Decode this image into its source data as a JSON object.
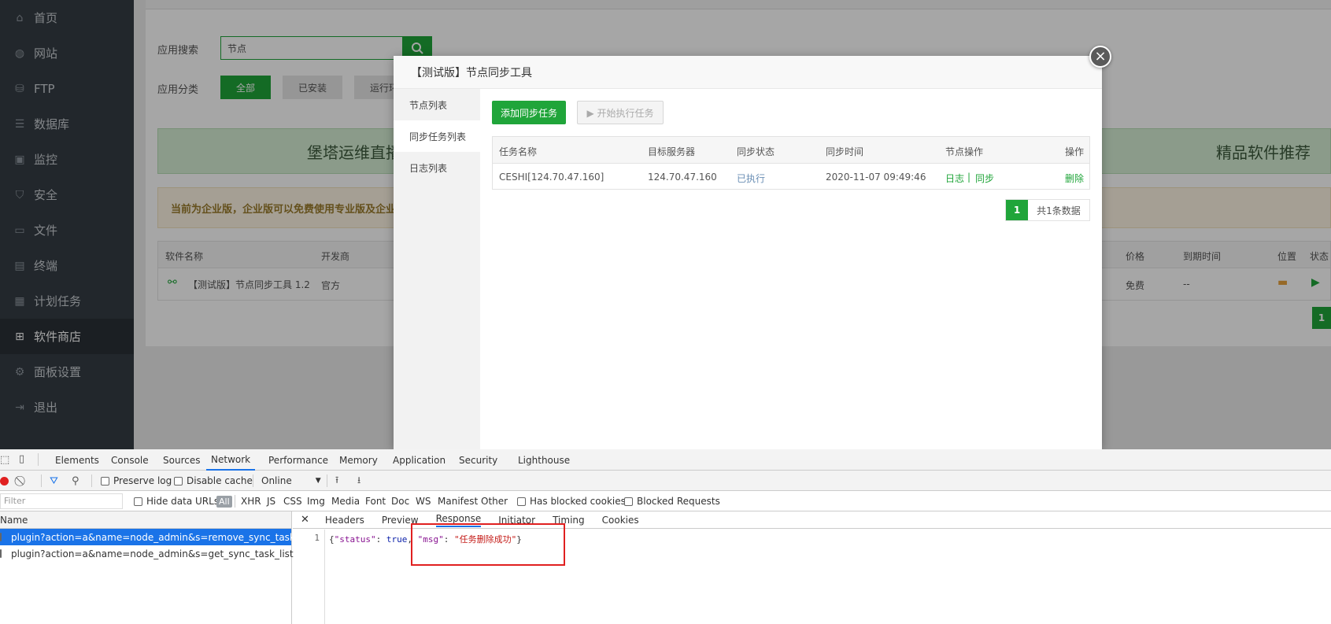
{
  "sidebar": {
    "items": [
      {
        "label": "首页",
        "icon": "home-icon"
      },
      {
        "label": "网站",
        "icon": "globe-icon"
      },
      {
        "label": "FTP",
        "icon": "ftp-icon"
      },
      {
        "label": "数据库",
        "icon": "database-icon"
      },
      {
        "label": "监控",
        "icon": "monitor-icon"
      },
      {
        "label": "安全",
        "icon": "shield-icon"
      },
      {
        "label": "文件",
        "icon": "folder-icon"
      },
      {
        "label": "终端",
        "icon": "terminal-icon"
      },
      {
        "label": "计划任务",
        "icon": "calendar-icon"
      },
      {
        "label": "软件商店",
        "icon": "grid-icon"
      },
      {
        "label": "面板设置",
        "icon": "gear-icon"
      },
      {
        "label": "退出",
        "icon": "logout-icon"
      }
    ],
    "active_index": 9
  },
  "main": {
    "search_label": "应用搜索",
    "search_value": "节点",
    "category_label": "应用分类",
    "categories": [
      "全部",
      "已安装",
      "运行环"
    ],
    "banner_left": "堡塔运维直播",
    "banner_right": "精品软件推荐",
    "notice": "当前为企业版，企业版可以免费使用专业版及企业",
    "soft_table": {
      "headers": [
        "软件名称",
        "开发商",
        "价格",
        "到期时间",
        "位置",
        "状态"
      ],
      "row": {
        "name": "【测试版】节点同步工具 1.2",
        "vendor": "官方",
        "price": "免费",
        "expire": "--"
      }
    },
    "page": "1"
  },
  "modal": {
    "title": "【测试版】节点同步工具",
    "tabs": [
      "节点列表",
      "同步任务列表",
      "日志列表"
    ],
    "active_tab": 1,
    "add_button": "添加同步任务",
    "run_button": "▶ 开始执行任务",
    "table": {
      "headers": [
        "任务名称",
        "目标服务器",
        "同步状态",
        "同步时间",
        "节点操作",
        "操作"
      ],
      "rows": [
        {
          "name": "CESHI[124.70.47.160]",
          "server": "124.70.47.160",
          "status": "已执行",
          "time": "2020-11-07 09:49:46",
          "node_log": "日志",
          "node_sep": "|",
          "node_sync": "同步",
          "action": "删除"
        }
      ]
    },
    "pager": {
      "current": "1",
      "info": "共1条数据"
    }
  },
  "devtools": {
    "tabs": [
      "Elements",
      "Console",
      "Sources",
      "Network",
      "Performance",
      "Memory",
      "Application",
      "Security",
      "Lighthouse"
    ],
    "active_tab": "Network",
    "toolbar": {
      "preserve_log": "Preserve log",
      "disable_cache": "Disable cache",
      "throttle": "Online"
    },
    "filterbar": {
      "placeholder": "Filter",
      "hide_data_urls": "Hide data URLs",
      "types": [
        "All",
        "XHR",
        "JS",
        "CSS",
        "Img",
        "Media",
        "Font",
        "Doc",
        "WS",
        "Manifest",
        "Other"
      ],
      "has_blocked": "Has blocked cookies",
      "blocked_requests": "Blocked Requests"
    },
    "requests": {
      "header": "Name",
      "rows": [
        "plugin?action=a&name=node_admin&s=remove_sync_task",
        "plugin?action=a&name=node_admin&s=get_sync_task_list"
      ]
    },
    "detail_tabs": [
      "Headers",
      "Preview",
      "Response",
      "Initiator",
      "Timing",
      "Cookies"
    ],
    "detail_active": "Response",
    "response": {
      "line_no": "1",
      "open": "{",
      "k1": "\"status\"",
      "c1": ": ",
      "v1": "true",
      "sep": ", ",
      "k2": "\"msg\"",
      "c2": ": ",
      "v2": "\"任务删除成功\"",
      "close": "}"
    }
  },
  "colors": {
    "accent": "#20a53a",
    "sidebar": "#353d44",
    "devtools_blue": "#1a73e8",
    "highlight": "#e02020"
  }
}
